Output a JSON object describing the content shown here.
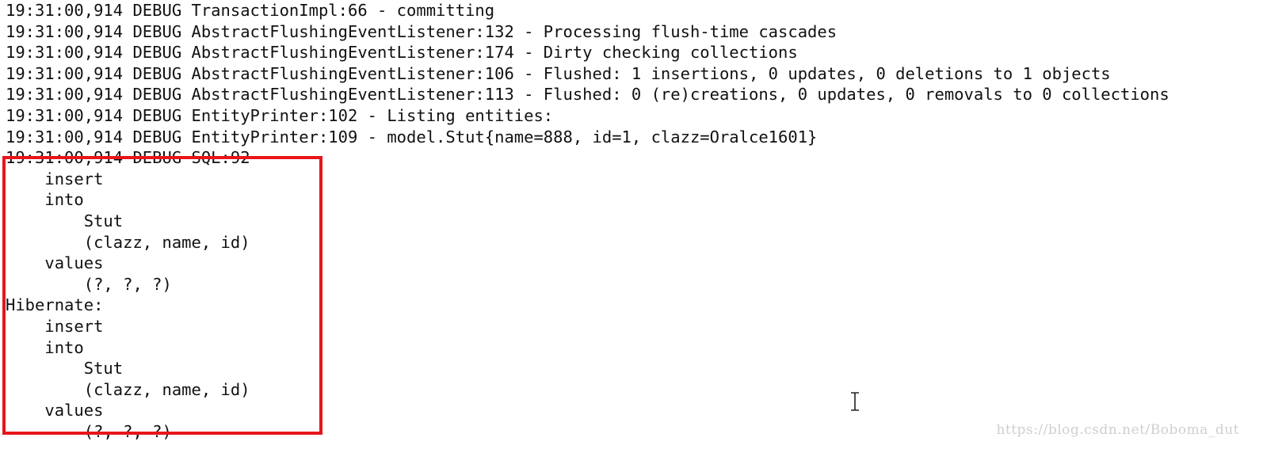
{
  "console": {
    "lines": [
      "19:31:00,914 DEBUG TransactionImpl:66 - committing",
      "19:31:00,914 DEBUG AbstractFlushingEventListener:132 - Processing flush-time cascades",
      "19:31:00,914 DEBUG AbstractFlushingEventListener:174 - Dirty checking collections",
      "19:31:00,914 DEBUG AbstractFlushingEventListener:106 - Flushed: 1 insertions, 0 updates, 0 deletions to 1 objects",
      "19:31:00,914 DEBUG AbstractFlushingEventListener:113 - Flushed: 0 (re)creations, 0 updates, 0 removals to 0 collections",
      "19:31:00,914 DEBUG EntityPrinter:102 - Listing entities:",
      "19:31:00,914 DEBUG EntityPrinter:109 - model.Stut{name=888, id=1, clazz=Oralce1601}",
      "19:31:00,914 DEBUG SQL:92 - ",
      "    insert ",
      "    into",
      "        Stut",
      "        (clazz, name, id) ",
      "    values",
      "        (?, ?, ?)",
      "Hibernate: ",
      "    insert ",
      "    into",
      "        Stut",
      "        (clazz, name, id) ",
      "    values",
      "        (?, ?, ?)"
    ]
  },
  "highlight": {
    "color": "#e8151b"
  },
  "cursor": {
    "icon": "text-ibeam-cursor-icon"
  },
  "watermark": {
    "text": "https://blog.csdn.net/Boboma_dut"
  }
}
